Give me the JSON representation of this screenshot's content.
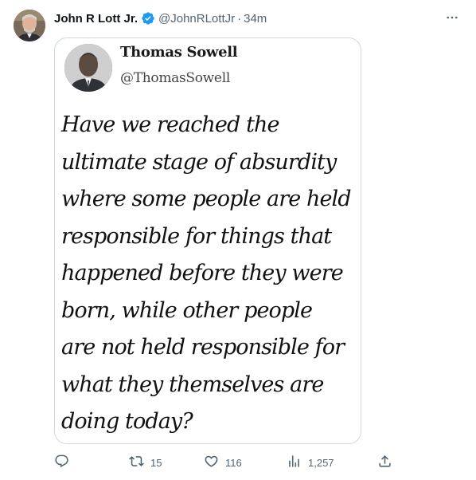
{
  "author": {
    "name": "John R Lott Jr.",
    "handle": "@JohnRLottJr",
    "separator": "·",
    "time": "34m",
    "verified": true
  },
  "icons": {
    "verified": "verified-badge-icon",
    "more": "more-options-icon",
    "reply": "reply-icon",
    "retweet": "retweet-icon",
    "like": "like-icon",
    "views": "views-icon",
    "share": "share-icon"
  },
  "colors": {
    "verified_badge": "#1d9bf0",
    "secondary_text": "#536471",
    "primary_text": "#0f1419",
    "border": "#cfd9de"
  },
  "media": {
    "quoted_name": "Thomas Sowell",
    "quoted_handle": "@ThomasSowell",
    "quote_lines": [
      "Have we reached the",
      "ultimate stage of absurdity",
      "where some people are held",
      "responsible for things that",
      "happened before they were",
      "born, while other people",
      "are not held responsible for",
      "what they themselves are",
      "doing today?"
    ]
  },
  "actions": {
    "reply_count": "",
    "retweet_count": "15",
    "like_count": "116",
    "view_count": "1,257"
  }
}
